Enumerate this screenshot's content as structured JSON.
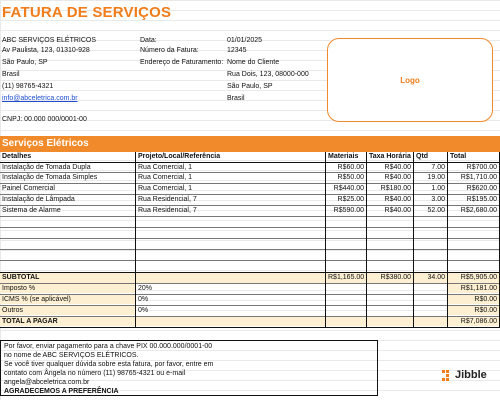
{
  "header": {
    "title": "FATURA DE SERVIÇOS",
    "company_name": "ABC SERVIÇOS ELÉTRICOS",
    "company_address": "Av Paulista, 123, 01310-928",
    "company_city": "São Paulo, SP",
    "company_country": "Brasil",
    "company_phone": "(11) 98765-4321",
    "company_email": "info@abceletrica.com.br",
    "cnpj": "CNPJ:  00.000 000/0001-00",
    "date_label": "Data:",
    "date_value": "01/01/2025",
    "invoice_number_label": "Número da Fatura:",
    "invoice_number_value": "12345",
    "billing_address_label": "Endereço de Faturamento:",
    "client_name": "Nome do Cliente",
    "client_street": "Rua Dois, 123, 08000-000",
    "client_city": "São Paulo, SP",
    "client_country": "Brasil",
    "logo_label": "Logo"
  },
  "section_title": "Serviços Elétricos",
  "table": {
    "headers": {
      "details": "Detalhes",
      "project": "Projeto/Local/Referência",
      "materials": "Materiais",
      "hourly_rate": "Taxa Horária",
      "qty": "Qtd",
      "total": "Total"
    },
    "rows": [
      {
        "details": "Instalação de Tomada Dupla",
        "project": "Rua Comercial, 1",
        "materials": "R$60.00",
        "rate": "R$40.00",
        "qty": "7.00",
        "total": "R$700.00"
      },
      {
        "details": "Instalação de Tomada Simples",
        "project": "Rua Comercial, 1",
        "materials": "R$50.00",
        "rate": "R$40.00",
        "qty": "19.00",
        "total": "R$1,710.00"
      },
      {
        "details": "Painel Comercial",
        "project": "Rua Comercial, 1",
        "materials": "R$440.00",
        "rate": "R$180.00",
        "qty": "1.00",
        "total": "R$620.00"
      },
      {
        "details": "Instalação de Lâmpada",
        "project": "Rua Residencial, 7",
        "materials": "R$25.00",
        "rate": "R$40.00",
        "qty": "3.00",
        "total": "R$195.00"
      },
      {
        "details": "Sistema de Alarme",
        "project": "Rua Residencial, 7",
        "materials": "R$590.00",
        "rate": "R$40.00",
        "qty": "52.00",
        "total": "R$2,680.00"
      }
    ],
    "subtotal_label": "SUBTOTAL",
    "subtotal_materials": "R$1,165.00",
    "subtotal_rate": "R$380.00",
    "subtotal_qty": "34.00",
    "subtotal_total": "R$5,905.00",
    "tax_label": "Imposto %",
    "tax_rate": "20%",
    "tax_total": "R$1,181.00",
    "icms_label": "ICMS % (se aplicável)",
    "icms_rate": "0%",
    "icms_total": "R$0.00",
    "others_label": "Outros",
    "others_rate": "0%",
    "others_total": "R$0.00",
    "grand_total_label": "TOTAL A PAGAR",
    "grand_total": "R$7,086.00"
  },
  "footer": {
    "line1": "Por favor, enviar pagamento para a chave PIX 00.000.000/0001-00",
    "line2": "no nome de ABC SERVIÇOS ELÉTRICOS.",
    "line3": "Se você tiver qualquer dúvida sobre esta fatura, por favor, entre em",
    "line4": "contato com Ângela no número (11) 98765-4321 ou e-mail",
    "line5": "angela@abceletrica.com.br",
    "line6": "AGRADECEMOS A PREFERÊNCIA"
  },
  "brand": {
    "name": "Jibble",
    "color": "#f07c1a"
  },
  "colors": {
    "accent": "#f08a2a",
    "summary_fill": "#fdf0d2",
    "link": "#1f4fd0"
  }
}
